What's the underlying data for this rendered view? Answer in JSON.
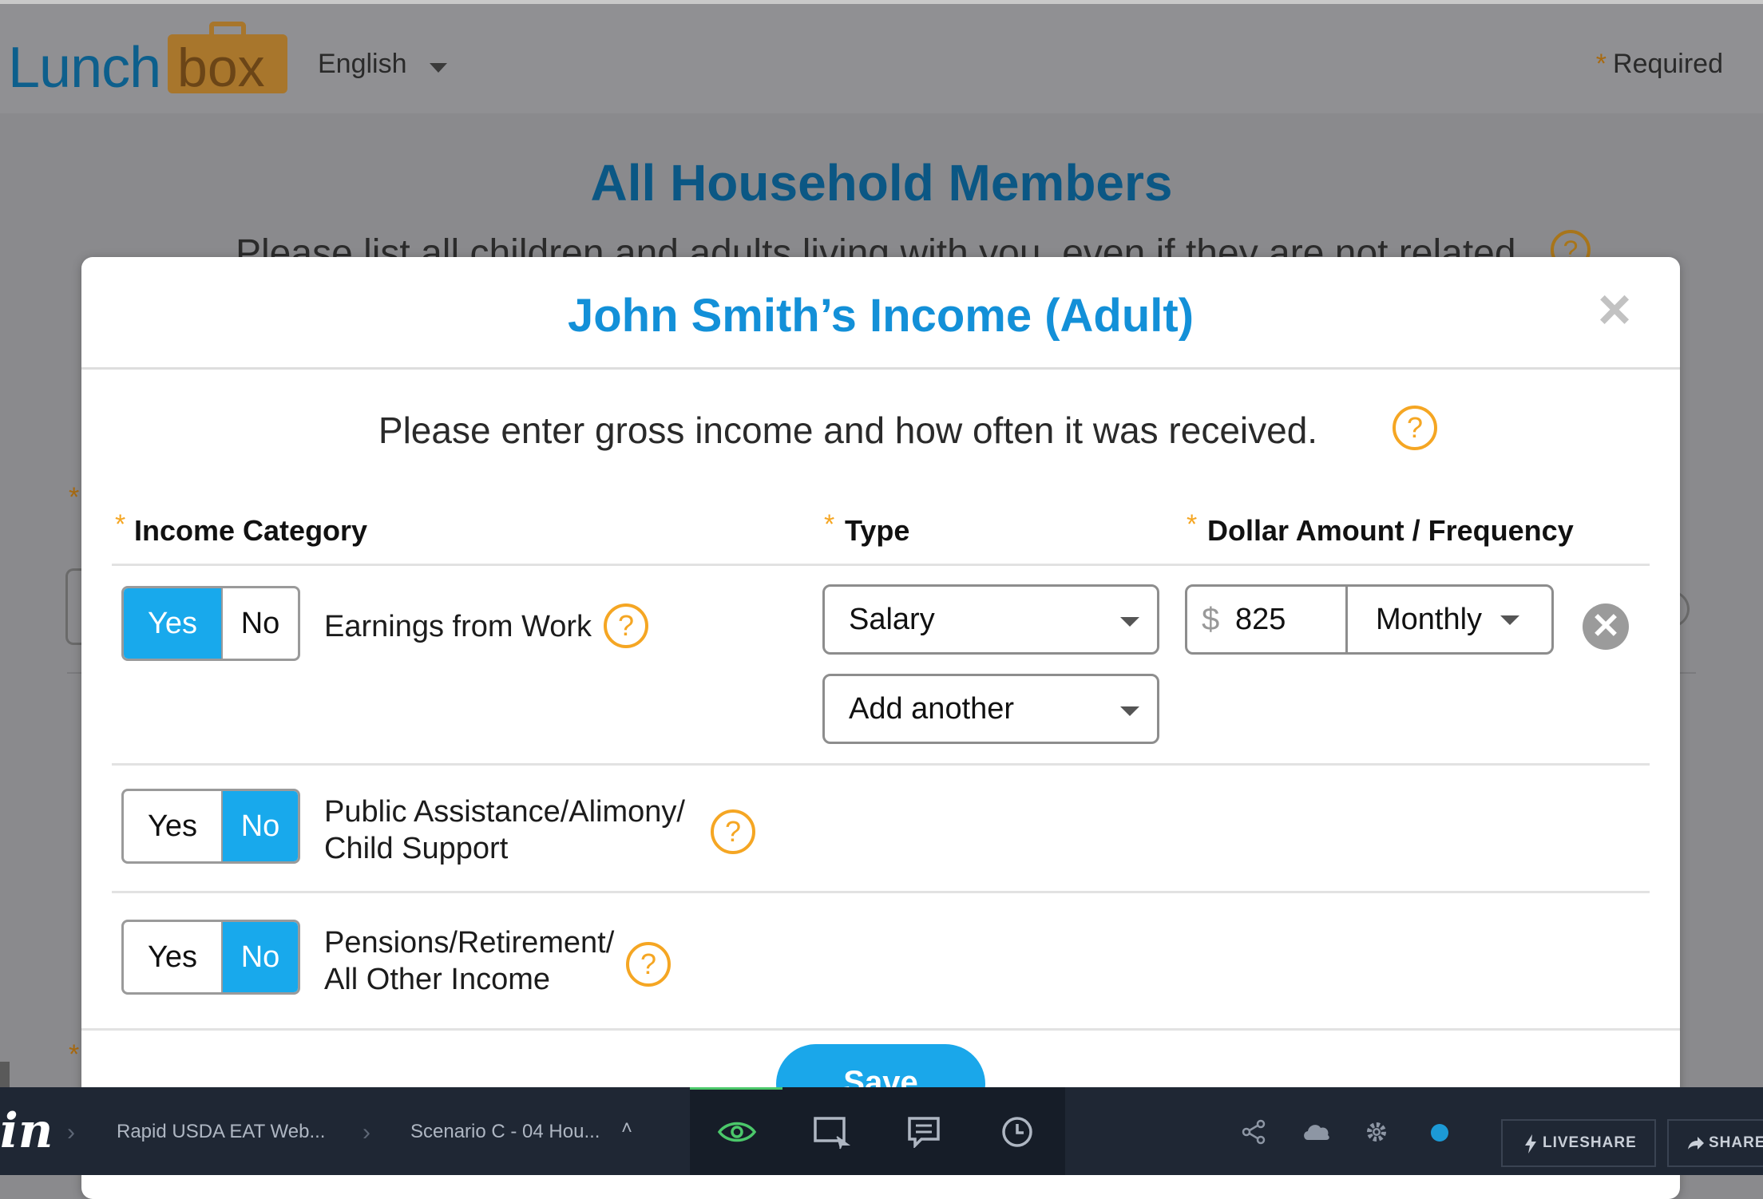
{
  "header": {
    "logo_part1": "Lunch",
    "logo_part2": "box",
    "language": "English",
    "required_star": "*",
    "required_label": "Required"
  },
  "background_page": {
    "title": "All Household Members",
    "subtitle": "Please list all children and adults living with you, even if they are not related",
    "help_glyph": "?"
  },
  "modal": {
    "title": "John Smith’s Income (Adult)",
    "close_glyph": "×",
    "intro": "Please enter gross income and how often it was received.",
    "help_glyph": "?",
    "columns": {
      "category": "Income Category",
      "type": "Type",
      "amount": "Dollar Amount / Frequency",
      "star": "*"
    },
    "rows": [
      {
        "yes": "Yes",
        "no": "No",
        "selected": "Yes",
        "label_line1": "Earnings from Work",
        "label_line2": "",
        "type_value": "Salary",
        "add_another": "Add another",
        "currency": "$",
        "amount": "825",
        "frequency": "Monthly",
        "remove_glyph": "✕"
      },
      {
        "yes": "Yes",
        "no": "No",
        "selected": "No",
        "label_line1": "Public Assistance/Alimony/",
        "label_line2": "Child Support"
      },
      {
        "yes": "Yes",
        "no": "No",
        "selected": "No",
        "label_line1": "Pensions/Retirement/",
        "label_line2": "All Other Income"
      }
    ],
    "save_label": "Save"
  },
  "bottom_bar": {
    "logo": "in",
    "crumb1": "Rapid USDA EAT Web...",
    "crumb2": "Scenario C - 04 Hou...",
    "crumb2_caret": "˄",
    "liveshare_label": "LIVESHARE",
    "share_label": "SHARE"
  },
  "colors": {
    "accent_blue": "#18a9ec",
    "title_blue": "#1390d8",
    "help_orange": "#f5a623",
    "overlay_gray": "#8a8a8d",
    "bottom_bar": "#1f2734"
  }
}
